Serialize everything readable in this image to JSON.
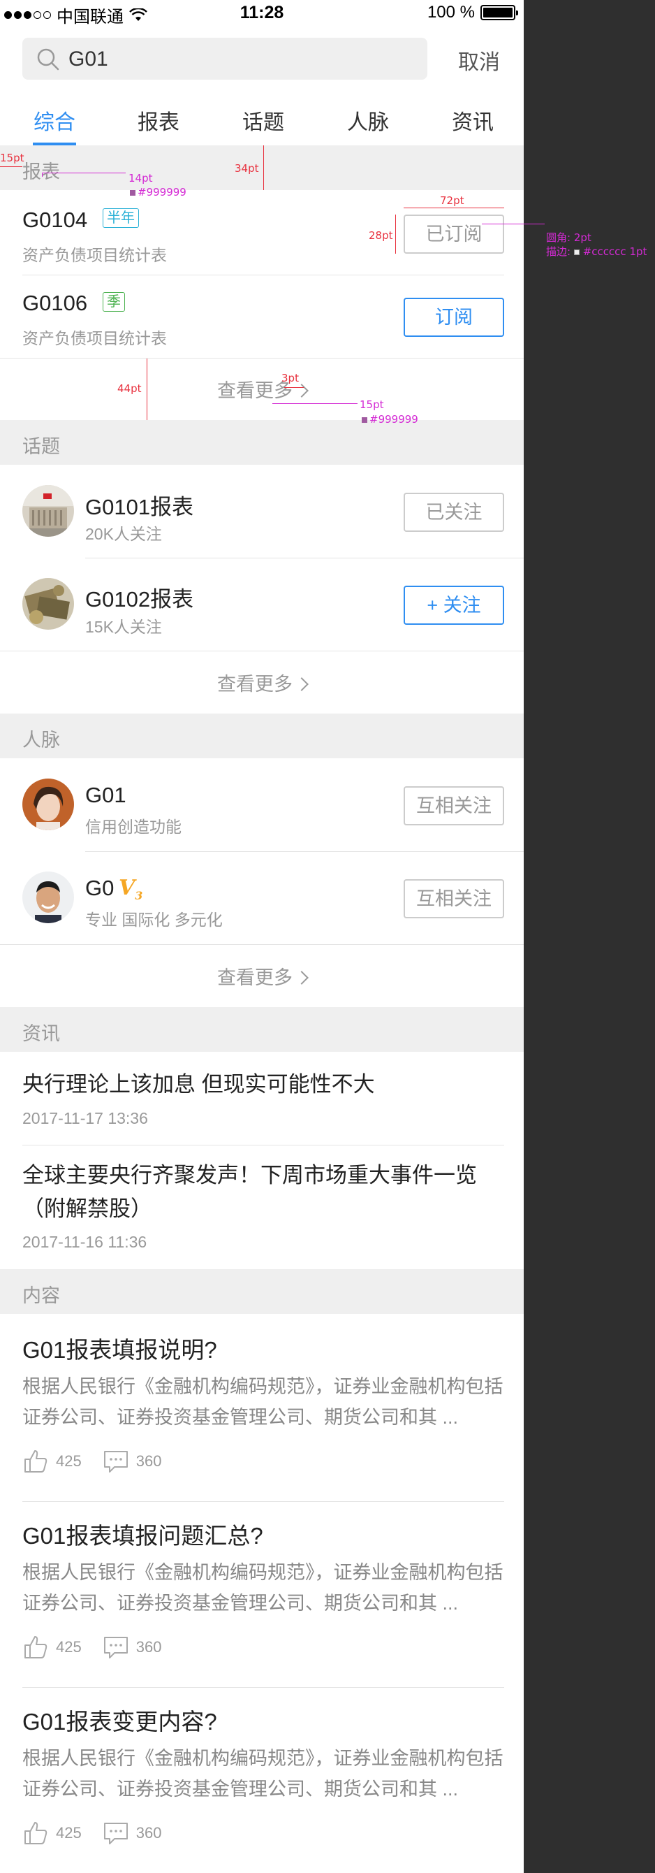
{
  "status": {
    "carrier": "中国联通",
    "time": "11:28",
    "battery": "100 %"
  },
  "search": {
    "value": "G01",
    "cancel": "取消"
  },
  "tabs": [
    "综合",
    "报表",
    "话题",
    "人脉",
    "资讯"
  ],
  "sections": {
    "reports": "报表",
    "topics": "话题",
    "people": "人脉",
    "news": "资讯",
    "content": "内容"
  },
  "reports": [
    {
      "title": "G0104",
      "badge": "半年",
      "sub": "资产负债项目统计表",
      "button": "已订阅"
    },
    {
      "title": "G0106",
      "badge": "季",
      "sub": "资产负债项目统计表",
      "button": "订阅"
    }
  ],
  "more_label": "查看更多",
  "topics": [
    {
      "title": "G0101报表",
      "sub": "20K人关注",
      "button": "已关注"
    },
    {
      "title": "G0102报表",
      "sub": "15K人关注",
      "button": "+ 关注"
    }
  ],
  "people": [
    {
      "name": "G01",
      "sub": "信用创造功能",
      "button": "互相关注"
    },
    {
      "name": "G0",
      "vip": "V3",
      "sub": "专业 国际化 多元化",
      "button": "互相关注"
    }
  ],
  "news": [
    {
      "title": "央行理论上该加息 但现实可能性不大",
      "time": "2017-11-17 13:36"
    },
    {
      "title": "全球主要央行齐聚发声！下周市场重大事件一览（附解禁股）",
      "time": "2017-11-16 11:36"
    }
  ],
  "contents": [
    {
      "title": "G01报表填报说明?",
      "body": "根据人民银行《金融机构编码规范》，证券业金融机构包括证券公司、证券投资基金管理公司、期货公司和其 ...",
      "likes": "425",
      "comments": "360"
    },
    {
      "title": "G01报表填报问题汇总?",
      "body": "根据人民银行《金融机构编码规范》，证券业金融机构包括证券公司、证券投资基金管理公司、期货公司和其 ...",
      "likes": "425",
      "comments": "360"
    },
    {
      "title": "G01报表变更内容?",
      "body": "根据人民银行《金融机构编码规范》，证券业金融机构包括证券公司、证券投资基金管理公司、期货公司和其 ...",
      "likes": "425",
      "comments": "360"
    }
  ],
  "annotations": {
    "a15pt": "15pt",
    "a14pt": "14pt",
    "c999": "#999999",
    "a34pt": "34pt",
    "a72pt": "72pt",
    "a28pt": "28pt",
    "radius": "圆角: 2pt",
    "stroke": "描边:",
    "strokeColor": "#cccccc",
    "strokeWidth": "1pt",
    "a44pt": "44pt",
    "a3pt": "3pt",
    "a15pt2": "15pt",
    "c999b": "#999999"
  },
  "colors": {
    "accent": "#2f8ef1",
    "text": "#222222",
    "muted": "#999999",
    "border": "#cccccc",
    "section": "#efefef"
  }
}
